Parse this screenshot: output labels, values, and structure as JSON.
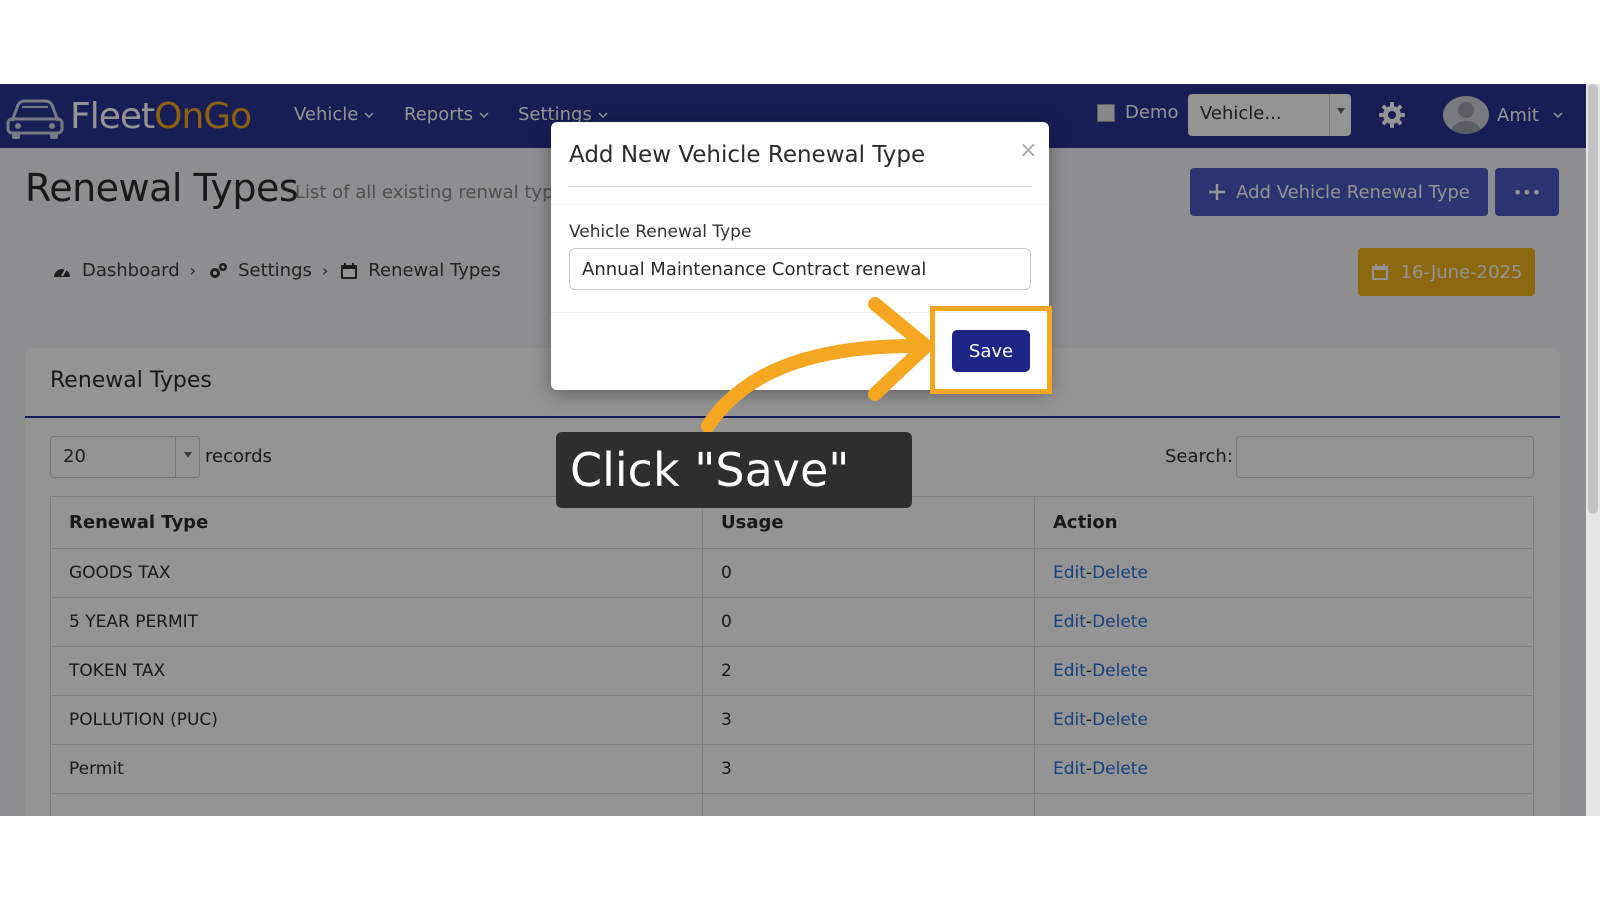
{
  "navbar": {
    "brand_part1": "Fleet",
    "brand_part2": "OnGo",
    "menu": [
      "Vehicle",
      "Reports",
      "Settings"
    ],
    "demo_label": "Demo",
    "vehicle_select": "Vehicle...",
    "user_name": "Amit"
  },
  "header": {
    "title": "Renewal Types",
    "subtitle": "List of all existing renwal types",
    "add_button": "Add Vehicle Renewal Type",
    "more_button": "•••",
    "date": "16-June-2025"
  },
  "breadcrumb": {
    "items": [
      "Dashboard",
      "Settings",
      "Renewal Types"
    ]
  },
  "card": {
    "title": "Renewal Types",
    "page_length": "20",
    "records_label": "records",
    "search_label": "Search:",
    "columns": [
      "Renewal Type",
      "Usage",
      "Action"
    ],
    "rows": [
      {
        "type": "GOODS TAX",
        "usage": "0",
        "edit": "Edit",
        "sep": "-",
        "delete": "Delete"
      },
      {
        "type": "5 YEAR PERMIT",
        "usage": "0",
        "edit": "Edit",
        "sep": "-",
        "delete": "Delete"
      },
      {
        "type": "TOKEN TAX",
        "usage": "2",
        "edit": "Edit",
        "sep": "-",
        "delete": "Delete"
      },
      {
        "type": "POLLUTION (PUC)",
        "usage": "3",
        "edit": "Edit",
        "sep": "-",
        "delete": "Delete"
      },
      {
        "type": "Permit",
        "usage": "3",
        "edit": "Edit",
        "sep": "-",
        "delete": "Delete"
      }
    ]
  },
  "modal": {
    "title": "Add New Vehicle Renewal Type",
    "close": "×",
    "field_label": "Vehicle Renewal Type",
    "field_value": "Annual Maintenance Contract renewal",
    "save_button": "Save"
  },
  "annotation": {
    "tooltip": "Click \"Save\"",
    "highlight_color": "#f5a722"
  },
  "colors": {
    "navbar": "#2a3493",
    "primary_button": "#4a59c2",
    "date_button": "#f0b21c",
    "save_button": "#1d2585",
    "link": "#2a6fd6"
  }
}
